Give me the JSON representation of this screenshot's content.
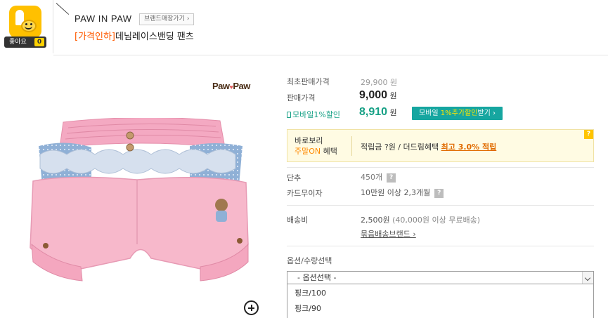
{
  "like": {
    "label": "좋아요",
    "count": "0",
    "icon": "thumbs-up-smile-icon"
  },
  "brand": {
    "name": "PAW IN PAW",
    "shop_link": "브랜드매장가기 ›"
  },
  "product": {
    "tag": "[가격인하]",
    "title": "데님레이스밴딩 팬츠"
  },
  "logo": {
    "text_left": "Paw",
    "text_right": "Paw",
    "heart": "♥"
  },
  "pricing": {
    "orig_label": "최초판매가격",
    "orig_value": "29,900 원",
    "sale_label": "판매가격",
    "sale_value": "9,000",
    "sale_unit": "원",
    "mobile_label": "모바일1%할인",
    "mobile_value": "8,910",
    "mobile_unit": "원",
    "mobile_btn_pre": "모바일 ",
    "mobile_btn_hl": "1%추가할인",
    "mobile_btn_post": "받기 ›"
  },
  "promo": {
    "line1": "바로보리",
    "line2_on": "주말ON",
    "line2_rest": " 혜택",
    "text": "적립금 ?원 / 더드림혜택 ",
    "max": "최고 3.0% 적립",
    "help": "?"
  },
  "details": {
    "button_label": "단추",
    "button_value": "450개",
    "card_label": "카드무이자",
    "card_value": "10만원 이상 2,3개월",
    "shipping_label": "배송비",
    "shipping_value": "2,500원",
    "shipping_note": "(40,000원 이상 무료배송)",
    "bundle_link": "묶음배송브랜드 ›",
    "help": "?"
  },
  "options": {
    "label": "옵션/수량선택",
    "selected": "- 옵션선택 -",
    "items": [
      "핑크/100",
      "핑크/90"
    ]
  },
  "colors": {
    "accent": "#ff5a00",
    "mobile": "#16a085",
    "promo_bg": "#fffbe3",
    "like_yellow": "#ffc000"
  }
}
